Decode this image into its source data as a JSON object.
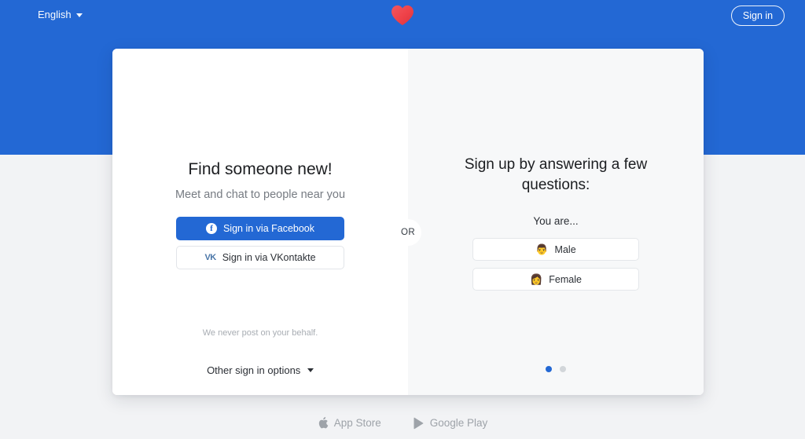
{
  "topbar": {
    "language_label": "English",
    "language_caret_icon": "chevron-down-icon",
    "logo_icon": "heart-logo-icon",
    "signin_label": "Sign in"
  },
  "left_panel": {
    "title": "Find someone new!",
    "subtitle": "Meet and chat to people near you",
    "facebook_button": {
      "label": "Sign in via Facebook",
      "icon": "facebook-icon",
      "glyph": "f"
    },
    "vkontakte_button": {
      "label": "Sign in via VKontakte",
      "icon": "vkontakte-icon",
      "glyph": "VK"
    },
    "disclaimer": "We never post on your behalf.",
    "other_options_label": "Other sign in options",
    "other_options_caret_icon": "chevron-down-icon"
  },
  "divider": {
    "or_label": "OR"
  },
  "right_panel": {
    "title": "Sign up by answering a few questions:",
    "question": "You are...",
    "options": [
      {
        "label": "Male",
        "emoji": "👨",
        "icon": "male-emoji-icon"
      },
      {
        "label": "Female",
        "emoji": "👩",
        "icon": "female-emoji-icon"
      }
    ],
    "pagination": {
      "total": 2,
      "active_index": 0
    }
  },
  "footer": {
    "app_store": {
      "label": "App Store",
      "icon": "apple-icon"
    },
    "google_play": {
      "label": "Google Play",
      "icon": "google-play-icon"
    }
  },
  "colors": {
    "brand_blue": "#2368d4",
    "page_background": "#f2f3f5",
    "card_white": "#ffffff",
    "card_tint": "#f7f8f9",
    "heart_red": "#ef4444",
    "vk_blue": "#4a76a8",
    "muted_text": "#9ea3a9"
  }
}
